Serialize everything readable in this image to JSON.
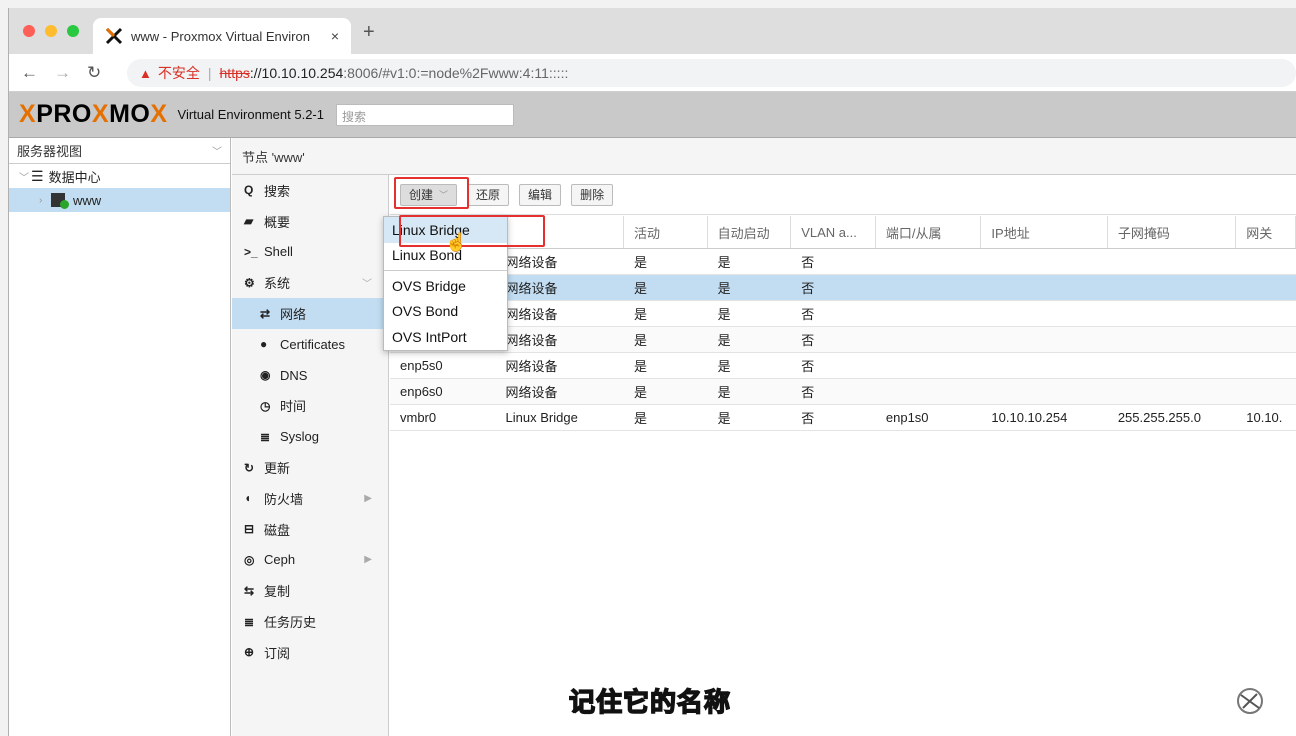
{
  "browser": {
    "tab_title": "www - Proxmox Virtual Environ",
    "close_glyph": "×",
    "newtab_glyph": "+",
    "insecure_label": "不安全",
    "url_scheme": "https",
    "url_host": "://10.10.10.254",
    "url_rest": ":8006/#v1:0:=node%2Fwww:4:11:::::"
  },
  "header": {
    "logo_x": "X",
    "logo_p1": "PRO",
    "logo_x2": "X",
    "logo_p2": "MO",
    "logo_x3": "X",
    "version": "Virtual Environment 5.2-1",
    "search_placeholder": "搜索"
  },
  "tree": {
    "view_selector": "服务器视图",
    "datacenter": "数据中心",
    "node": "www"
  },
  "node_title": "节点 'www'",
  "menu": [
    {
      "icon": "Q",
      "label": "搜索"
    },
    {
      "icon": "▰",
      "label": "概要"
    },
    {
      "icon": ">_",
      "label": "Shell"
    },
    {
      "icon": "⚙",
      "label": "系统"
    },
    {
      "icon": "⇄",
      "label": "网络"
    },
    {
      "icon": "●",
      "label": "Certificates"
    },
    {
      "icon": "◉",
      "label": "DNS"
    },
    {
      "icon": "◷",
      "label": "时间"
    },
    {
      "icon": "≣",
      "label": "Syslog"
    },
    {
      "icon": "↻",
      "label": "更新"
    },
    {
      "icon": "◖",
      "label": "防火墙"
    },
    {
      "icon": "⊟",
      "label": "磁盘"
    },
    {
      "icon": "◎",
      "label": "Ceph"
    },
    {
      "icon": "⇆",
      "label": "复制"
    },
    {
      "icon": "≣",
      "label": "任务历史"
    },
    {
      "icon": "⊕",
      "label": "订阅"
    }
  ],
  "toolbar": {
    "create": "创建",
    "revert": "还原",
    "edit": "编辑",
    "delete": "删除"
  },
  "grid": {
    "headers": [
      "",
      "",
      "活动",
      "自动启动",
      "VLAN a...",
      "端口/从属",
      "IP地址",
      "子网掩码",
      "网关"
    ],
    "rows": [
      [
        "",
        "网络设备",
        "是",
        "是",
        "否",
        "",
        "",
        "",
        ""
      ],
      [
        "",
        "网络设备",
        "是",
        "是",
        "否",
        "",
        "",
        "",
        ""
      ],
      [
        "",
        "网络设备",
        "是",
        "是",
        "否",
        "",
        "",
        "",
        ""
      ],
      [
        "enp4s0",
        "网络设备",
        "是",
        "是",
        "否",
        "",
        "",
        "",
        ""
      ],
      [
        "enp5s0",
        "网络设备",
        "是",
        "是",
        "否",
        "",
        "",
        "",
        ""
      ],
      [
        "enp6s0",
        "网络设备",
        "是",
        "是",
        "否",
        "",
        "",
        "",
        ""
      ],
      [
        "vmbr0",
        "Linux Bridge",
        "是",
        "是",
        "否",
        "enp1s0",
        "10.10.10.254",
        "255.255.255.0",
        "10.10."
      ]
    ]
  },
  "dropdown": [
    "Linux Bridge",
    "Linux Bond",
    "OVS Bridge",
    "OVS Bond",
    "OVS IntPort"
  ],
  "subtitle": "记住它的名称",
  "colors": {
    "accent": "#e57000",
    "selection": "#c2ddf2",
    "highlight_box": "#e53030"
  }
}
